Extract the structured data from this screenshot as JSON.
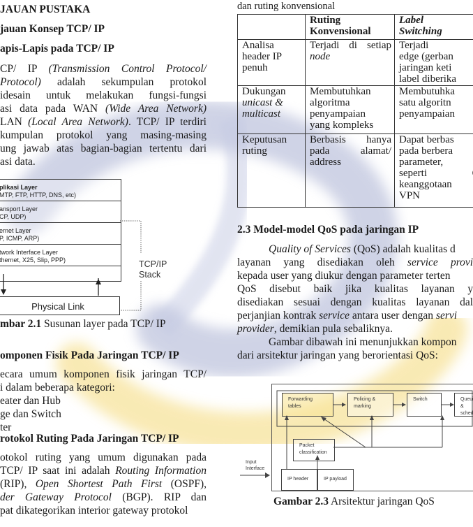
{
  "left": {
    "chapter_heading": "JAUAN PUSTAKA",
    "section_heading": "jauan Konsep TCP/ IP",
    "subsection_heading": "apis-Lapis pada TCP/ IP",
    "intro_lines": [
      {
        "parts": [
          {
            "t": "CP/  IP  "
          },
          {
            "t": "(Transmission  Control  Protocol/",
            "i": true
          }
        ]
      },
      {
        "parts": [
          {
            "t": " Protocol)",
            "i": true
          },
          {
            "t": "  adalah  sekumpulan  protokol"
          }
        ]
      },
      {
        "parts": [
          {
            "t": "idesain   untuk   melakukan   fungsi-fungsi"
          }
        ]
      },
      {
        "parts": [
          {
            "t": "asi data pada WAN "
          },
          {
            "t": "(Wide Area Network)",
            "i": true
          }
        ]
      },
      {
        "parts": [
          {
            "t": "LAN "
          },
          {
            "t": "(Local Area Network)",
            "i": true
          },
          {
            "t": ". TCP/ IP terdiri"
          }
        ]
      },
      {
        "parts": [
          {
            "t": "kumpulan  protokol  yang  masing-masing"
          }
        ]
      },
      {
        "parts": [
          {
            "t": "ung jawab atas bagian-bagian tertentu dari"
          }
        ]
      },
      {
        "parts": [
          {
            "t": "asi data."
          }
        ]
      }
    ],
    "figure1": {
      "layers": [
        {
          "name": "plikasi Layer",
          "protocols": "MTP, FTP, HTTP, DNS, etc)"
        },
        {
          "name": "ansport Layer",
          "protocols": "CP, UDP)"
        },
        {
          "name": "ernet Layer",
          "protocols": "P, ICMP, ARP)"
        },
        {
          "name": "twork Interface Layer",
          "protocols": "thernet, X25, Slip, PPP)"
        }
      ],
      "physical_link": "Physical Link",
      "stack_label_1": "TCP/IP",
      "stack_label_2": "Stack",
      "caption_bold": "mbar 2.1",
      "caption_text": " Susunan layer pada TCP/ IP"
    },
    "components_heading": "omponen Fisik Pada Jaringan TCP/ IP",
    "components_lines": [
      "ecara umum komponen fisik jaringan TCP/",
      "i dalam beberapa kategori:"
    ],
    "components_list": [
      "eater dan Hub",
      "ge dan Switch",
      "ter"
    ],
    "routing_heading": "rotokol Ruting Pada Jaringan TCP/ IP",
    "routing_lines": [
      {
        "parts": [
          {
            "t": "otokol ruting yang umum digunakan pada"
          }
        ]
      },
      {
        "parts": [
          {
            "t": "TCP/ IP saat ini adalah "
          },
          {
            "t": "Routing Information",
            "i": true
          }
        ]
      },
      {
        "parts": [
          {
            "t": " (RIP), "
          },
          {
            "t": "Open Shortest Path First",
            "i": true
          },
          {
            "t": " (OSPF),"
          }
        ]
      },
      {
        "parts": [
          {
            "t": "der  Gateway  Protocol",
            "i": true
          },
          {
            "t": "  (BGP).  RIP  dan"
          }
        ]
      },
      {
        "parts": [
          {
            "t": "pat dikategorikan interior gateway protokol"
          }
        ]
      }
    ]
  },
  "right": {
    "table_caption": "dan ruting konvensional",
    "table": {
      "headers": [
        {
          "lines": [
            ""
          ]
        },
        {
          "lines": [
            "Ruting",
            "Konvensional"
          ]
        },
        {
          "lines": [
            "Label",
            "Switching"
          ],
          "italic": true
        }
      ],
      "rows": [
        [
          {
            "lines": [
              {
                "t": "Analisa"
              },
              {
                "t": "header IP"
              },
              {
                "t": "penuh"
              }
            ]
          },
          {
            "lines": [
              {
                "t": "Terjadi di setiap",
                "j": true
              },
              {
                "t": "node",
                "i": true
              }
            ]
          },
          {
            "lines": [
              {
                "t": "Terjadi    pa",
                "j": true
              },
              {
                "t": "edge (gerban"
              },
              {
                "t": "jaringan keti"
              },
              {
                "t": "label diberika"
              }
            ]
          }
        ],
        [
          {
            "lines": [
              {
                "t": "Dukungan"
              },
              {
                "t": "unicast &",
                "i": true
              },
              {
                "t": "multicast",
                "i": true
              }
            ]
          },
          {
            "lines": [
              {
                "t": "Membutuhkan"
              },
              {
                "t": "algoritma"
              },
              {
                "t": "penyampaian"
              },
              {
                "t": "yang kompleks"
              }
            ]
          },
          {
            "lines": [
              {
                "t": "Membutuhka"
              },
              {
                "t": "satu  algoritn"
              },
              {
                "t": "penyampaian"
              }
            ]
          }
        ],
        [
          {
            "lines": [
              {
                "t": "Keputusan"
              },
              {
                "t": "ruting"
              }
            ]
          },
          {
            "lines": [
              {
                "t": "Berbasis   hanya",
                "j": true
              },
              {
                "t": "pada      alamat/",
                "j": true
              },
              {
                "t": "address"
              }
            ]
          },
          {
            "lines": [
              {
                "t": "Dapat berbas"
              },
              {
                "t": "pada  berbera"
              },
              {
                "t": "parameter,"
              },
              {
                "t": "seperti    Qo",
                "j": true
              },
              {
                "t": "keanggotaan"
              },
              {
                "t": "VPN"
              }
            ]
          }
        ]
      ]
    },
    "section_heading": "2.3  Model-model QoS pada jaringan IP",
    "qos_lines": [
      {
        "parts": [
          {
            "t": "Quality of Services",
            "i": true
          },
          {
            "t": " (QoS) adalah kualitas d"
          }
        ],
        "indent": true
      },
      {
        "parts": [
          {
            "t": "layanan   yang   disediakan   oleh   "
          },
          {
            "t": "service  provic",
            "i": true
          }
        ],
        "j": true
      },
      {
        "parts": [
          {
            "t": "kepada user yang diukur dengan parameter terten"
          }
        ]
      },
      {
        "parts": [
          {
            "t": "QoS    disebut    baik    jika    kualitas    layanan    ya"
          }
        ],
        "j": true
      },
      {
        "parts": [
          {
            "t": "disediakan   sesuai   dengan   kualitas   layanan   dala"
          }
        ],
        "j": true
      },
      {
        "parts": [
          {
            "t": "perjanjian kontrak "
          },
          {
            "t": "service",
            "i": true
          },
          {
            "t": " antara user dengan "
          },
          {
            "t": "servi",
            "i": true
          }
        ]
      },
      {
        "parts": [
          {
            "t": "provider",
            "i": true
          },
          {
            "t": ", demikian pula sebaliknya."
          }
        ]
      },
      {
        "parts": [
          {
            "t": "Gambar dibawah ini menunjukkan kompon"
          }
        ],
        "indent": true
      },
      {
        "parts": [
          {
            "t": "dari arsitektur jaringan yang berorientasi QoS:"
          }
        ]
      }
    ],
    "figure3": {
      "boxes": {
        "forwarding_1": "Forwarding",
        "forwarding_2": "tables",
        "policing_1": "Policing &",
        "policing_2": "marking",
        "switch": "Switch",
        "queuing_1": "Queuing &",
        "queuing_2": "scheduling",
        "packet_1": "Packet",
        "packet_2": "classification",
        "ip_header": "IP header",
        "ip_payload": "IP payload"
      },
      "input_1": "Input",
      "input_2": "Interface",
      "caption_bold": "Gambar 2.3",
      "caption_text": " Arsitektur jaringan QoS"
    }
  },
  "watermark": {
    "blue": "#9aa3c8",
    "yellow": "#f3d36a"
  }
}
